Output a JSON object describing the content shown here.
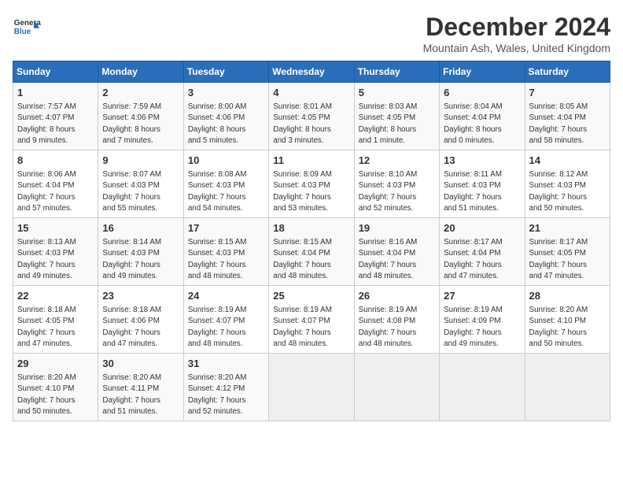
{
  "header": {
    "logo_line1": "General",
    "logo_line2": "Blue",
    "month": "December 2024",
    "location": "Mountain Ash, Wales, United Kingdom"
  },
  "columns": [
    "Sunday",
    "Monday",
    "Tuesday",
    "Wednesday",
    "Thursday",
    "Friday",
    "Saturday"
  ],
  "weeks": [
    [
      {
        "day": "1",
        "info": "Sunrise: 7:57 AM\nSunset: 4:07 PM\nDaylight: 8 hours\nand 9 minutes."
      },
      {
        "day": "2",
        "info": "Sunrise: 7:59 AM\nSunset: 4:06 PM\nDaylight: 8 hours\nand 7 minutes."
      },
      {
        "day": "3",
        "info": "Sunrise: 8:00 AM\nSunset: 4:06 PM\nDaylight: 8 hours\nand 5 minutes."
      },
      {
        "day": "4",
        "info": "Sunrise: 8:01 AM\nSunset: 4:05 PM\nDaylight: 8 hours\nand 3 minutes."
      },
      {
        "day": "5",
        "info": "Sunrise: 8:03 AM\nSunset: 4:05 PM\nDaylight: 8 hours\nand 1 minute."
      },
      {
        "day": "6",
        "info": "Sunrise: 8:04 AM\nSunset: 4:04 PM\nDaylight: 8 hours\nand 0 minutes."
      },
      {
        "day": "7",
        "info": "Sunrise: 8:05 AM\nSunset: 4:04 PM\nDaylight: 7 hours\nand 58 minutes."
      }
    ],
    [
      {
        "day": "8",
        "info": "Sunrise: 8:06 AM\nSunset: 4:04 PM\nDaylight: 7 hours\nand 57 minutes."
      },
      {
        "day": "9",
        "info": "Sunrise: 8:07 AM\nSunset: 4:03 PM\nDaylight: 7 hours\nand 55 minutes."
      },
      {
        "day": "10",
        "info": "Sunrise: 8:08 AM\nSunset: 4:03 PM\nDaylight: 7 hours\nand 54 minutes."
      },
      {
        "day": "11",
        "info": "Sunrise: 8:09 AM\nSunset: 4:03 PM\nDaylight: 7 hours\nand 53 minutes."
      },
      {
        "day": "12",
        "info": "Sunrise: 8:10 AM\nSunset: 4:03 PM\nDaylight: 7 hours\nand 52 minutes."
      },
      {
        "day": "13",
        "info": "Sunrise: 8:11 AM\nSunset: 4:03 PM\nDaylight: 7 hours\nand 51 minutes."
      },
      {
        "day": "14",
        "info": "Sunrise: 8:12 AM\nSunset: 4:03 PM\nDaylight: 7 hours\nand 50 minutes."
      }
    ],
    [
      {
        "day": "15",
        "info": "Sunrise: 8:13 AM\nSunset: 4:03 PM\nDaylight: 7 hours\nand 49 minutes."
      },
      {
        "day": "16",
        "info": "Sunrise: 8:14 AM\nSunset: 4:03 PM\nDaylight: 7 hours\nand 49 minutes."
      },
      {
        "day": "17",
        "info": "Sunrise: 8:15 AM\nSunset: 4:03 PM\nDaylight: 7 hours\nand 48 minutes."
      },
      {
        "day": "18",
        "info": "Sunrise: 8:15 AM\nSunset: 4:04 PM\nDaylight: 7 hours\nand 48 minutes."
      },
      {
        "day": "19",
        "info": "Sunrise: 8:16 AM\nSunset: 4:04 PM\nDaylight: 7 hours\nand 48 minutes."
      },
      {
        "day": "20",
        "info": "Sunrise: 8:17 AM\nSunset: 4:04 PM\nDaylight: 7 hours\nand 47 minutes."
      },
      {
        "day": "21",
        "info": "Sunrise: 8:17 AM\nSunset: 4:05 PM\nDaylight: 7 hours\nand 47 minutes."
      }
    ],
    [
      {
        "day": "22",
        "info": "Sunrise: 8:18 AM\nSunset: 4:05 PM\nDaylight: 7 hours\nand 47 minutes."
      },
      {
        "day": "23",
        "info": "Sunrise: 8:18 AM\nSunset: 4:06 PM\nDaylight: 7 hours\nand 47 minutes."
      },
      {
        "day": "24",
        "info": "Sunrise: 8:19 AM\nSunset: 4:07 PM\nDaylight: 7 hours\nand 48 minutes."
      },
      {
        "day": "25",
        "info": "Sunrise: 8:19 AM\nSunset: 4:07 PM\nDaylight: 7 hours\nand 48 minutes."
      },
      {
        "day": "26",
        "info": "Sunrise: 8:19 AM\nSunset: 4:08 PM\nDaylight: 7 hours\nand 48 minutes."
      },
      {
        "day": "27",
        "info": "Sunrise: 8:19 AM\nSunset: 4:09 PM\nDaylight: 7 hours\nand 49 minutes."
      },
      {
        "day": "28",
        "info": "Sunrise: 8:20 AM\nSunset: 4:10 PM\nDaylight: 7 hours\nand 50 minutes."
      }
    ],
    [
      {
        "day": "29",
        "info": "Sunrise: 8:20 AM\nSunset: 4:10 PM\nDaylight: 7 hours\nand 50 minutes."
      },
      {
        "day": "30",
        "info": "Sunrise: 8:20 AM\nSunset: 4:11 PM\nDaylight: 7 hours\nand 51 minutes."
      },
      {
        "day": "31",
        "info": "Sunrise: 8:20 AM\nSunset: 4:12 PM\nDaylight: 7 hours\nand 52 minutes."
      },
      null,
      null,
      null,
      null
    ]
  ]
}
